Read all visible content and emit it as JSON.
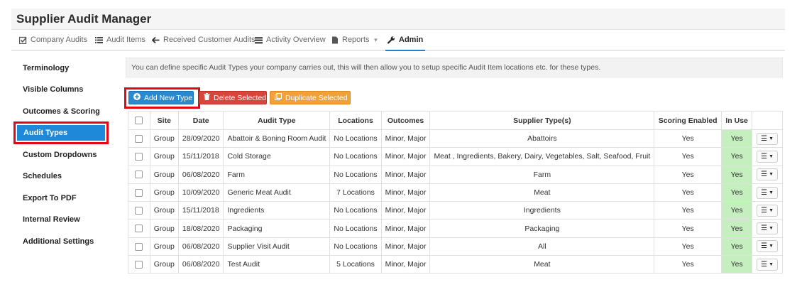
{
  "app": {
    "title": "Supplier Audit Manager"
  },
  "nav": [
    {
      "label": "Company Audits",
      "icon": "checkbox-icon"
    },
    {
      "label": "Audit Items",
      "icon": "list-icon"
    },
    {
      "label": "Received Customer Audits",
      "icon": "arrow-left-icon"
    },
    {
      "label": "Activity Overview",
      "icon": "server-icon"
    },
    {
      "label": "Reports",
      "icon": "document-icon"
    },
    {
      "label": "Admin",
      "icon": "wrench-icon"
    }
  ],
  "sidebar": {
    "items": [
      "Terminology",
      "Visible Columns",
      "Outcomes & Scoring",
      "Audit Types",
      "Custom Dropdowns",
      "Schedules",
      "Export To PDF",
      "Internal Review",
      "Additional Settings"
    ],
    "active": "Audit Types"
  },
  "info": {
    "text": "You can define specific Audit Types your company carries out, this will then allow you to setup specific Audit Item locations etc. for these types."
  },
  "toolbar": {
    "add_label": "Add New Type",
    "delete_label": "Delete Selected",
    "duplicate_label": "Duplicate Selected"
  },
  "colors": {
    "accent": "#1e88d9",
    "delete": "#d9453a",
    "duplicate": "#f2a13a",
    "in_use": "#c6efc0",
    "highlight": "#e30613"
  },
  "table": {
    "headers": {
      "site": "Site",
      "date": "Date",
      "type": "Audit Type",
      "locations": "Locations",
      "outcomes": "Outcomes",
      "suppliers": "Supplier Type(s)",
      "scoring": "Scoring Enabled",
      "inuse": "In Use"
    },
    "rows": [
      {
        "site": "Group",
        "date": "28/09/2020",
        "type": "Abattoir & Boning Room Audit",
        "locations": "No Locations",
        "outcomes": "Minor, Major",
        "suppliers": "Abattoirs",
        "scoring": "Yes",
        "inuse": "Yes"
      },
      {
        "site": "Group",
        "date": "15/11/2018",
        "type": "Cold Storage",
        "locations": "No Locations",
        "outcomes": "Minor, Major",
        "suppliers": "Meat , Ingredients, Bakery, Dairy, Vegetables, Salt, Seafood, Fruit",
        "scoring": "Yes",
        "inuse": "Yes"
      },
      {
        "site": "Group",
        "date": "06/08/2020",
        "type": "Farm",
        "locations": "No Locations",
        "outcomes": "Minor, Major",
        "suppliers": "Farm",
        "scoring": "Yes",
        "inuse": "Yes"
      },
      {
        "site": "Group",
        "date": "10/09/2020",
        "type": "Generic Meat Audit",
        "locations": "7 Locations",
        "outcomes": "Minor, Major",
        "suppliers": "Meat",
        "scoring": "Yes",
        "inuse": "Yes"
      },
      {
        "site": "Group",
        "date": "15/11/2018",
        "type": "Ingredients",
        "locations": "No Locations",
        "outcomes": "Minor, Major",
        "suppliers": "Ingredients",
        "scoring": "Yes",
        "inuse": "Yes"
      },
      {
        "site": "Group",
        "date": "18/08/2020",
        "type": "Packaging",
        "locations": "No Locations",
        "outcomes": "Minor, Major",
        "suppliers": "Packaging",
        "scoring": "Yes",
        "inuse": "Yes"
      },
      {
        "site": "Group",
        "date": "06/08/2020",
        "type": "Supplier Visit Audit",
        "locations": "No Locations",
        "outcomes": "Minor, Major",
        "suppliers": "All",
        "scoring": "Yes",
        "inuse": "Yes"
      },
      {
        "site": "Group",
        "date": "06/08/2020",
        "type": "Test Audit",
        "locations": "5 Locations",
        "outcomes": "Minor, Major",
        "suppliers": "Meat",
        "scoring": "Yes",
        "inuse": "Yes"
      }
    ]
  }
}
